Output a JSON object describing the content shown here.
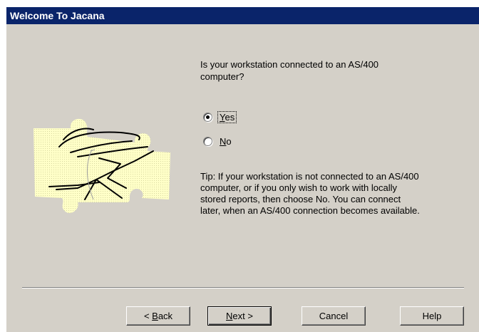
{
  "window": {
    "title": "Welcome To Jacana"
  },
  "main": {
    "question": "Is your workstation connected to an AS/400 computer?",
    "options": [
      {
        "prefix": "",
        "mnemonic": "Y",
        "rest": "es",
        "selected": true
      },
      {
        "prefix": "",
        "mnemonic": "N",
        "rest": "o",
        "selected": false
      }
    ],
    "tip": "Tip: If your workstation is not connected to an AS/400 computer, or if you only wish to work with locally stored reports, then choose No.  You can connect later, when an AS/400 connection becomes available.",
    "illustration": "puzzle-piece-icon"
  },
  "buttons": {
    "back": {
      "prefix": "< ",
      "mnemonic": "B",
      "rest": "ack"
    },
    "next": {
      "prefix": "",
      "mnemonic": "N",
      "rest": "ext >"
    },
    "cancel": "Cancel",
    "help": "Help"
  },
  "colors": {
    "titlebar": "#0a246a",
    "face": "#d4d0c8",
    "puzzle_fill": "#ffffc8"
  }
}
